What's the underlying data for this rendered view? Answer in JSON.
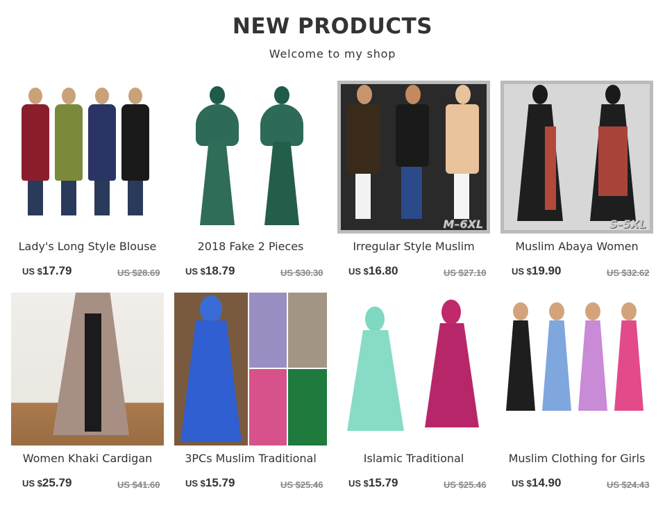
{
  "header": {
    "title": "NEW PRODUCTS",
    "subtitle": "Welcome to my shop"
  },
  "products": [
    {
      "name": "Lady's Long Style Blouse",
      "currency": "US $",
      "price": "17.79",
      "old_price": "US $28.69",
      "badge": ""
    },
    {
      "name": "2018 Fake 2 Pieces",
      "currency": "US $",
      "price": "18.79",
      "old_price": "US $30.30",
      "badge": ""
    },
    {
      "name": "Irregular Style Muslim",
      "currency": "US $",
      "price": "16.80",
      "old_price": "US $27.10",
      "badge": "M–6XL"
    },
    {
      "name": "Muslim Abaya Women",
      "currency": "US $",
      "price": "19.90",
      "old_price": "US $32.62",
      "badge": "S–5XL"
    },
    {
      "name": "Women Khaki Cardigan",
      "currency": "US $",
      "price": "25.79",
      "old_price": "US $41.60",
      "badge": ""
    },
    {
      "name": "3PCs Muslim Traditional",
      "currency": "US $",
      "price": "15.79",
      "old_price": "US $25.46",
      "badge": ""
    },
    {
      "name": "Islamic Traditional",
      "currency": "US $",
      "price": "15.79",
      "old_price": "US $25.46",
      "badge": ""
    },
    {
      "name": "Muslim Clothing for Girls",
      "currency": "US $",
      "price": "14.90",
      "old_price": "US $24.43",
      "badge": ""
    }
  ]
}
